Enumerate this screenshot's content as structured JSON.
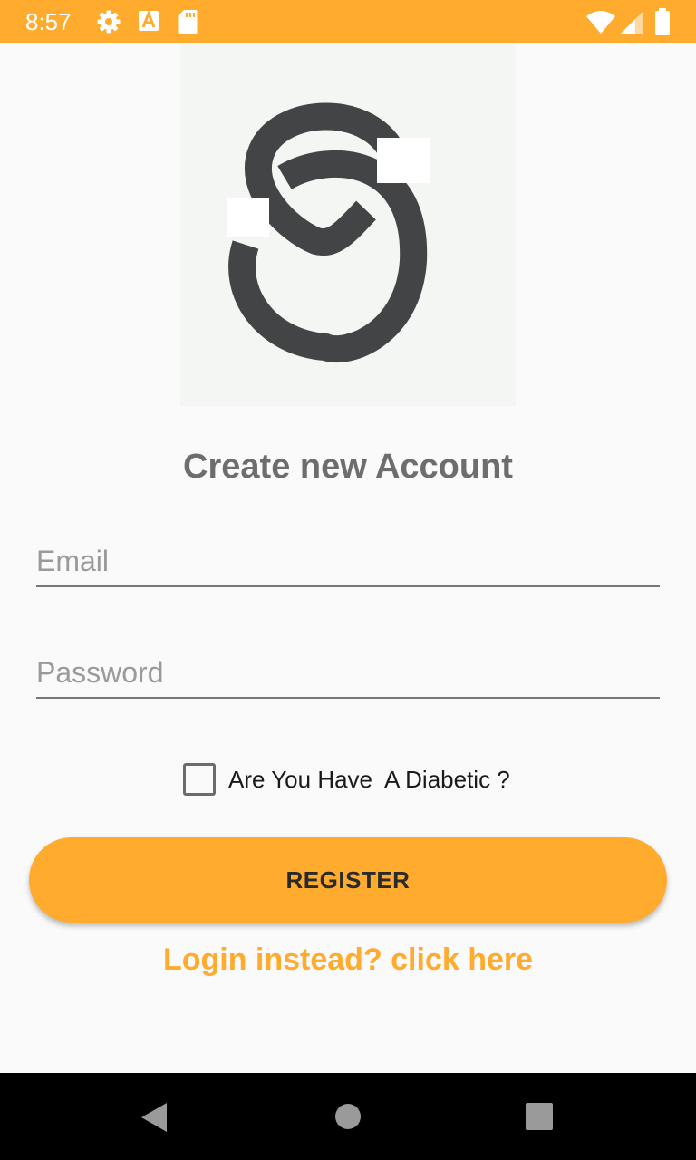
{
  "status_bar": {
    "time": "8:57",
    "icons": [
      "gear-icon",
      "a-icon",
      "sd-card-icon",
      "wifi-icon",
      "signal-icon",
      "battery-icon"
    ]
  },
  "logo": {
    "icon": "s-loop-logo-icon"
  },
  "title": "Create new Account",
  "form": {
    "email_placeholder": "Email",
    "email_value": "",
    "password_placeholder": "Password",
    "password_value": "",
    "diabetic_label": "Are You Have  A Diabetic ?",
    "diabetic_checked": false
  },
  "register_label": "REGISTER",
  "login_link": "Login instead? click here",
  "nav": {
    "icons": [
      "back-icon",
      "home-icon",
      "recents-icon"
    ]
  },
  "colors": {
    "accent": "#ffab2e",
    "title_text": "#6d6d6d",
    "logo": "#434445"
  }
}
